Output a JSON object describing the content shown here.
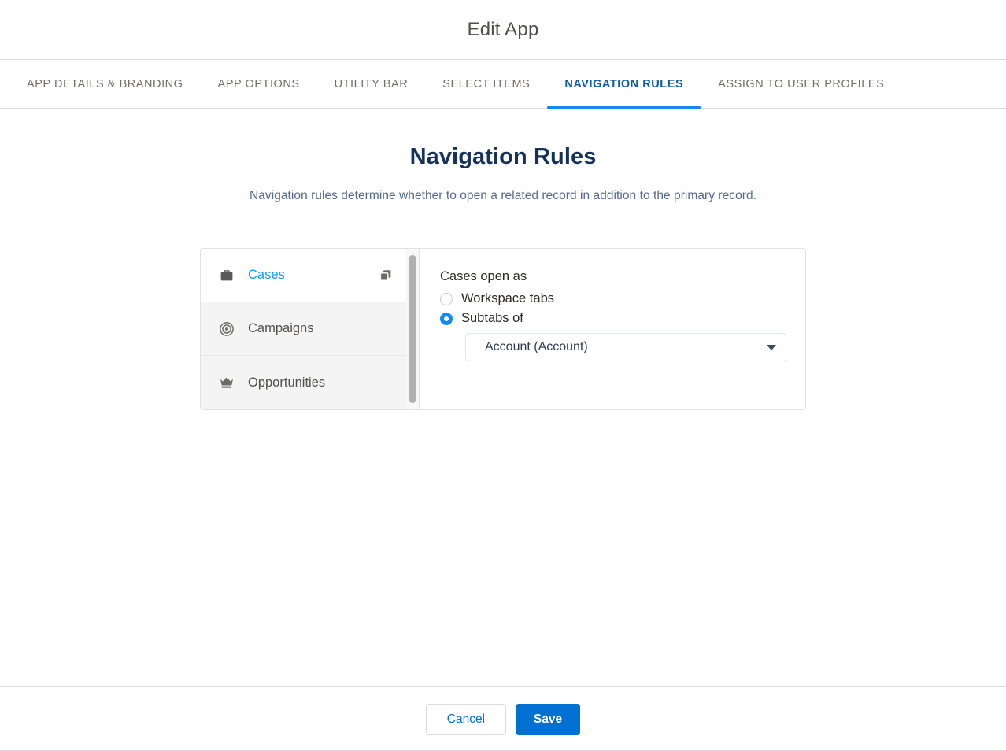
{
  "header": {
    "title": "Edit App"
  },
  "tabs": [
    {
      "label": "APP DETAILS & BRANDING",
      "name": "tab-app-details-branding",
      "active": false
    },
    {
      "label": "APP OPTIONS",
      "name": "tab-app-options",
      "active": false
    },
    {
      "label": "UTILITY BAR",
      "name": "tab-utility-bar",
      "active": false
    },
    {
      "label": "SELECT ITEMS",
      "name": "tab-select-items",
      "active": false
    },
    {
      "label": "NAVIGATION RULES",
      "name": "tab-navigation-rules",
      "active": true
    },
    {
      "label": "ASSIGN TO USER PROFILES",
      "name": "tab-assign-to-user-profiles",
      "active": false
    }
  ],
  "main": {
    "section_title": "Navigation Rules",
    "section_description": "Navigation rules determine whether to open a related record in addition to the primary record.",
    "objects": [
      {
        "label": "Cases",
        "icon": "briefcase-icon",
        "selected": true,
        "has_copy_action": true,
        "copy_icon": "copy-icon"
      },
      {
        "label": "Campaigns",
        "icon": "target-icon",
        "selected": false,
        "has_copy_action": false
      },
      {
        "label": "Opportunities",
        "icon": "crown-icon",
        "selected": false,
        "has_copy_action": false
      }
    ],
    "detail": {
      "heading": "Cases open as",
      "options": [
        {
          "label": "Workspace tabs",
          "checked": false
        },
        {
          "label": "Subtabs of",
          "checked": true
        }
      ],
      "parent_select": {
        "value": "Account (Account)",
        "arrow_icon": "chevron-down-icon"
      }
    }
  },
  "footer": {
    "cancel_label": "Cancel",
    "save_label": "Save"
  },
  "colors": {
    "accent_blue": "#1589ee",
    "brand_blue": "#0070d2",
    "link_blue": "#0d9dff",
    "title_navy": "#16325c",
    "subtitle_blue": "#54698d"
  }
}
